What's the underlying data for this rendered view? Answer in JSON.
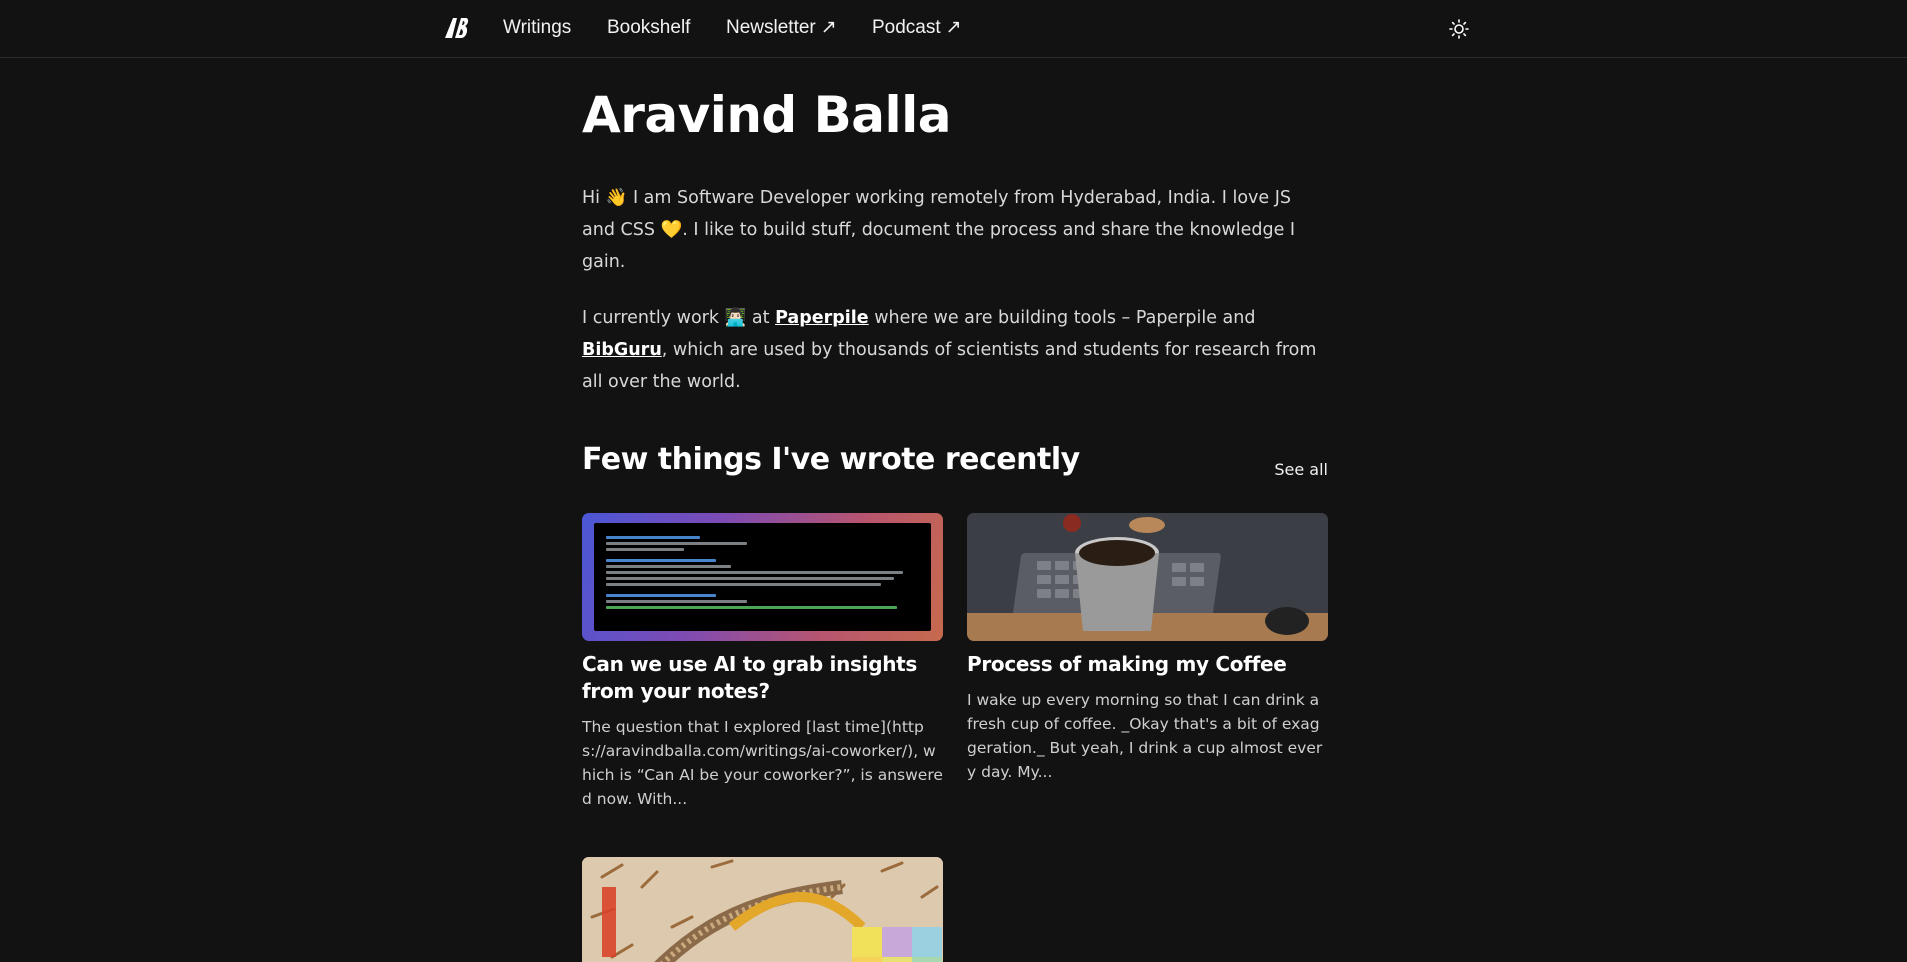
{
  "nav": {
    "logo_text": "AB",
    "links": [
      {
        "label": "Writings",
        "external": false
      },
      {
        "label": "Bookshelf",
        "external": false
      },
      {
        "label": "Newsletter",
        "external": true
      },
      {
        "label": "Podcast",
        "external": true
      }
    ],
    "external_icon": "↗",
    "theme_toggle_icon": "sun-icon"
  },
  "hero": {
    "name": "Aravind Balla",
    "bio1": {
      "before": "Hi ",
      "wave_emoji": "👋",
      "mid": " I am Software Developer working remotely from Hyderabad, India. I love JS and CSS ",
      "heart_emoji": "💛",
      "after": ". I like to build stuff, document the process and share the knowledge I gain."
    },
    "bio2": {
      "before": "I currently work ",
      "work_emoji": "👨🏻‍💻",
      "at": " at ",
      "link1": "Paperpile",
      "mid": " where we are building tools – Paperpile and ",
      "link2": "BibGuru",
      "after": ", which are used by thousands of scientists and students for research from all over the world."
    }
  },
  "writings": {
    "title": "Few things I've wrote recently",
    "see_all": "See all",
    "cards": [
      {
        "title": "Can we use AI to grab insights from your notes?",
        "excerpt": "The question that I explored [last time](https://aravindballa.com/writings/ai-coworker/), which is “Can AI be your coworker?”, is answered now. With..."
      },
      {
        "title": "Process of making my Coffee",
        "excerpt": "I wake up every morning so that I can drink a fresh cup of coffee. _Okay that's a bit of exaggeration._ But yeah, I drink a cup almost every day. My..."
      },
      {
        "title": "",
        "excerpt": ""
      }
    ]
  },
  "colors": {
    "background": "#121212",
    "text": "#e6e6e6",
    "heading": "#ffffff"
  }
}
